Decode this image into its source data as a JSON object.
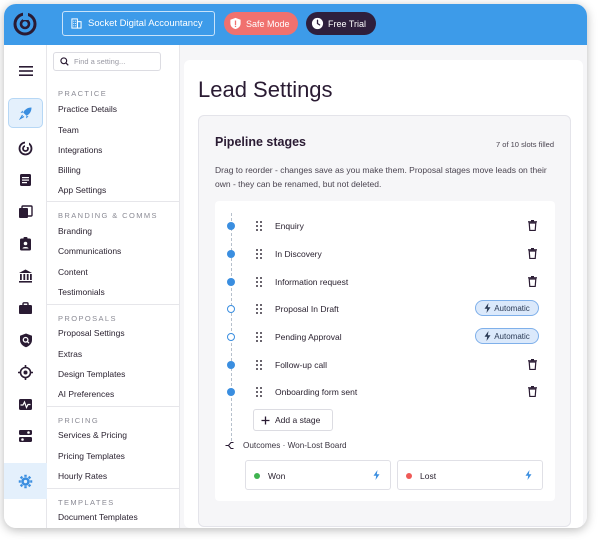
{
  "brand": {
    "accent": "#3d9be9",
    "dark": "#2e1f3c",
    "safe_color": "#f0716e"
  },
  "topbar": {
    "org_name": "Socket Digital Accountancy",
    "safe_mode_label": "Safe Mode",
    "free_trial_label": "Free Trial"
  },
  "rail_icons": [
    "hamburger-icon",
    "rocket-icon",
    "target-icon",
    "document-icon",
    "books-icon",
    "contact-card-icon",
    "bank-icon",
    "briefcase-icon",
    "shield-search-icon",
    "crosshair-icon",
    "pulse-icon",
    "toggles-icon",
    "gear-icon"
  ],
  "menu": {
    "search_placeholder": "Find a setting...",
    "sections": [
      {
        "title": "PRACTICE",
        "items": [
          "Practice Details",
          "Team",
          "Integrations",
          "Billing",
          "App Settings"
        ]
      },
      {
        "title": "BRANDING & COMMS",
        "items": [
          "Branding",
          "Communications",
          "Content",
          "Testimonials"
        ]
      },
      {
        "title": "PROPOSALS",
        "items": [
          "Proposal Settings",
          "Extras",
          "Design Templates",
          "AI Preferences"
        ]
      },
      {
        "title": "PRICING",
        "items": [
          "Services & Pricing",
          "Pricing Templates",
          "Hourly Rates"
        ]
      },
      {
        "title": "TEMPLATES",
        "items": [
          "Document Templates"
        ]
      }
    ]
  },
  "page": {
    "title": "Lead Settings",
    "card_title": "Pipeline stages",
    "slots": "7 of 10 slots filled",
    "description": "Drag to reorder - changes save as you make them. Proposal stages move leads on their own - they can be renamed, but not deleted.",
    "stages": [
      {
        "name": "Enquiry",
        "automatic": false
      },
      {
        "name": "In Discovery",
        "automatic": false
      },
      {
        "name": "Information request",
        "automatic": false
      },
      {
        "name": "Proposal In Draft",
        "automatic": true
      },
      {
        "name": "Pending Approval",
        "automatic": true
      },
      {
        "name": "Follow-up call",
        "automatic": false
      },
      {
        "name": "Onboarding form sent",
        "automatic": false
      }
    ],
    "automatic_label": "Automatic",
    "add_stage_label": "Add a stage",
    "outcomes_label": "Outcomes · Won-Lost Board",
    "outcomes": [
      {
        "name": "Won",
        "color": "#3fb34f"
      },
      {
        "name": "Lost",
        "color": "#ef5a57"
      }
    ]
  }
}
